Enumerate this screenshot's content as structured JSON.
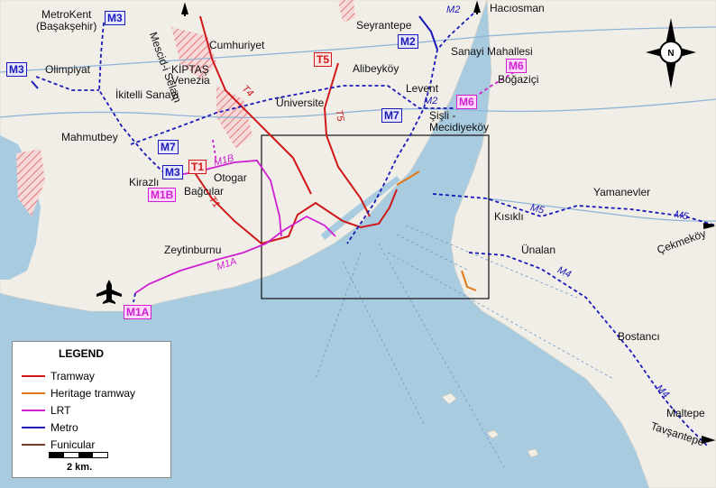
{
  "map": {
    "districts": [
      {
        "id": "metrokent",
        "text": "MetroKent\n(Başakşehir)"
      },
      {
        "id": "mescid",
        "text": "Mescid-i Selam"
      },
      {
        "id": "cumhuriyet",
        "text": "Cumhuriyet"
      },
      {
        "id": "seyrantepe",
        "text": "Seyrantepe"
      },
      {
        "id": "haciosman",
        "text": "Hacıosman"
      },
      {
        "id": "sanayi",
        "text": "Sanayi Mahallesi"
      },
      {
        "id": "olimpiyat",
        "text": "Olimpiyat"
      },
      {
        "id": "kiptas",
        "text": "KİPTAŞ\nVenezia"
      },
      {
        "id": "alibeykoy",
        "text": "Alibeyköy"
      },
      {
        "id": "bogazici",
        "text": "Boğaziçi"
      },
      {
        "id": "ikitelli",
        "text": "İkitelli Sanayi"
      },
      {
        "id": "universite",
        "text": "Üniversite"
      },
      {
        "id": "levent",
        "text": "Levent"
      },
      {
        "id": "sisli",
        "text": "Şişli -\nMecidiyeköy"
      },
      {
        "id": "mahmutbey",
        "text": "Mahmutbey"
      },
      {
        "id": "kirazli",
        "text": "Kirazlı"
      },
      {
        "id": "otogar",
        "text": "Otogar"
      },
      {
        "id": "bagcilar",
        "text": "Bağcılar"
      },
      {
        "id": "yamanevler",
        "text": "Yamanevler"
      },
      {
        "id": "kisikli",
        "text": "Kısıklı"
      },
      {
        "id": "zeytinburnu",
        "text": "Zeytinburnu"
      },
      {
        "id": "unalan",
        "text": "Ünalan"
      },
      {
        "id": "cekmekoy",
        "text": "Çekmeköy"
      },
      {
        "id": "bostanci",
        "text": "Bostancı"
      },
      {
        "id": "maltepe",
        "text": "Maltepe"
      },
      {
        "id": "tavsantepe",
        "text": "Tavşantepe"
      }
    ],
    "line_badges": [
      {
        "id": "m3-top",
        "text": "M3",
        "kind": "metro"
      },
      {
        "id": "m2-top",
        "text": "M2",
        "kind": "metro-italic"
      },
      {
        "id": "m2-box",
        "text": "M2",
        "kind": "metro"
      },
      {
        "id": "m3-left",
        "text": "M3",
        "kind": "metro"
      },
      {
        "id": "t5",
        "text": "T5",
        "kind": "tram"
      },
      {
        "id": "m6-a",
        "text": "M6",
        "kind": "lrt"
      },
      {
        "id": "m6-b",
        "text": "M6",
        "kind": "lrt"
      },
      {
        "id": "m7-a",
        "text": "M7",
        "kind": "metro"
      },
      {
        "id": "m7-b",
        "text": "M7",
        "kind": "metro"
      },
      {
        "id": "m3-mid",
        "text": "M3",
        "kind": "metro"
      },
      {
        "id": "t1",
        "text": "T1",
        "kind": "tram"
      },
      {
        "id": "m1b",
        "text": "M1B",
        "kind": "lrt"
      },
      {
        "id": "m1a",
        "text": "M1A",
        "kind": "lrt"
      }
    ],
    "route_labels": [
      {
        "id": "r-t4",
        "text": "T4",
        "color": "#d01818"
      },
      {
        "id": "r-t5",
        "text": "T5",
        "color": "#d01818"
      },
      {
        "id": "r-m2",
        "text": "M2",
        "color": "#1a1ab8"
      },
      {
        "id": "r-m1b",
        "text": "M1B",
        "color": "#d01fd0"
      },
      {
        "id": "r-t1",
        "text": "T1",
        "color": "#d01818"
      },
      {
        "id": "r-m1a",
        "text": "M1A",
        "color": "#d01fd0"
      },
      {
        "id": "r-m5a",
        "text": "M5",
        "color": "#1a1ab8"
      },
      {
        "id": "r-m5b",
        "text": "M5",
        "color": "#1a1ab8"
      },
      {
        "id": "r-m4a",
        "text": "M4",
        "color": "#1a1ab8"
      },
      {
        "id": "r-m4b",
        "text": "M4",
        "color": "#1a1ab8"
      }
    ],
    "compass_letter": "N"
  },
  "legend": {
    "title": "LEGEND",
    "items": [
      {
        "label": "Tramway",
        "color": "#d01818"
      },
      {
        "label": "Heritage tramway",
        "color": "#e07818"
      },
      {
        "label": "LRT",
        "color": "#d01fd0"
      },
      {
        "label": "Metro",
        "color": "#1a1ab8"
      },
      {
        "label": "Funicular",
        "color": "#7a3d2a"
      }
    ],
    "scale_label": "2 km."
  },
  "colors": {
    "water": "#a9cbe0",
    "land": "#f1eee8",
    "tram": "#d01818",
    "metro": "#1a1ab8",
    "lrt": "#d01fd0"
  }
}
